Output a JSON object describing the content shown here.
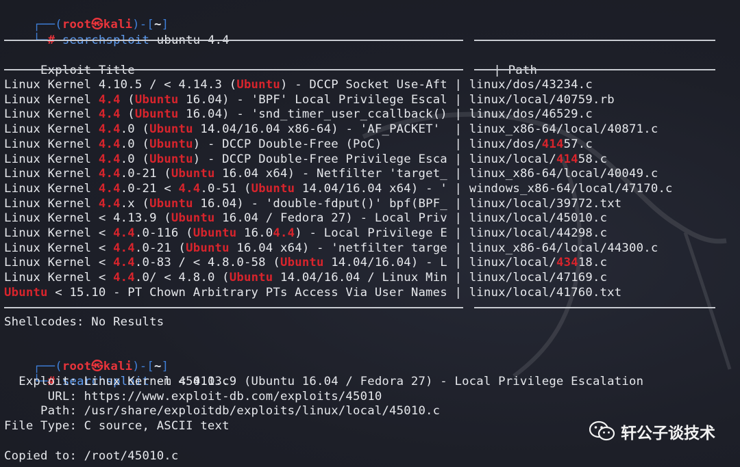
{
  "prompt": {
    "open": "┌──(",
    "user": "root",
    "skull": "㉿",
    "host": "kali",
    "mid": ")-[",
    "dir": "~",
    "close": "]",
    "second": "└─",
    "hash": "#"
  },
  "command1": {
    "name": "searchsploit",
    "args": " ubuntu 4.4"
  },
  "table": {
    "header_title": " Exploit Title",
    "header_sep": "|",
    "header_path": " Path",
    "rows": [
      {
        "segs": [
          [
            "n",
            "Linux Kernel 4.10.5 / < 4.14.3 ("
          ],
          [
            "h",
            "Ubuntu"
          ],
          [
            "n",
            ") - DCCP Socket Use-Aft | linux/dos/43234.c"
          ]
        ]
      },
      {
        "segs": [
          [
            "n",
            "Linux Kernel "
          ],
          [
            "h",
            "4.4"
          ],
          [
            "n",
            " ("
          ],
          [
            "h",
            "Ubuntu"
          ],
          [
            "n",
            " 16.04) - 'BPF' Local Privilege Escal | linux/local/40759.rb"
          ]
        ]
      },
      {
        "segs": [
          [
            "n",
            "Linux Kernel "
          ],
          [
            "h",
            "4.4"
          ],
          [
            "n",
            " ("
          ],
          [
            "h",
            "Ubuntu"
          ],
          [
            "n",
            " 16.04) - 'snd_timer_user_ccallback() | linux/dos/46529.c"
          ]
        ]
      },
      {
        "segs": [
          [
            "n",
            "Linux Kernel "
          ],
          [
            "h",
            "4.4"
          ],
          [
            "n",
            ".0 ("
          ],
          [
            "h",
            "Ubuntu"
          ],
          [
            "n",
            " 14.04/16.04 x86-64) - 'AF_PACKET'  | linux_x86-64/local/40871.c"
          ]
        ]
      },
      {
        "segs": [
          [
            "n",
            "Linux Kernel "
          ],
          [
            "h",
            "4.4"
          ],
          [
            "n",
            ".0 ("
          ],
          [
            "h",
            "Ubuntu"
          ],
          [
            "n",
            ") - DCCP Double-Free (PoC)          | linux/dos/"
          ],
          [
            "h",
            "414"
          ],
          [
            "n",
            "57.c"
          ]
        ]
      },
      {
        "segs": [
          [
            "n",
            "Linux Kernel "
          ],
          [
            "h",
            "4.4"
          ],
          [
            "n",
            ".0 ("
          ],
          [
            "h",
            "Ubuntu"
          ],
          [
            "n",
            ") - DCCP Double-Free Privilege Esca | linux/local/"
          ],
          [
            "h",
            "414"
          ],
          [
            "n",
            "58.c"
          ]
        ]
      },
      {
        "segs": [
          [
            "n",
            "Linux Kernel "
          ],
          [
            "h",
            "4.4"
          ],
          [
            "n",
            ".0-21 ("
          ],
          [
            "h",
            "Ubuntu"
          ],
          [
            "n",
            " 16.04 x64) - Netfilter 'target_ | linux_x86-64/local/40049.c"
          ]
        ]
      },
      {
        "segs": [
          [
            "n",
            "Linux Kernel "
          ],
          [
            "h",
            "4.4"
          ],
          [
            "n",
            ".0-21 < "
          ],
          [
            "h",
            "4.4"
          ],
          [
            "n",
            ".0-51 ("
          ],
          [
            "h",
            "Ubuntu"
          ],
          [
            "n",
            " 14.04/16.04 x64) - ' | windows_x86-64/local/47170.c"
          ]
        ]
      },
      {
        "segs": [
          [
            "n",
            "Linux Kernel "
          ],
          [
            "h",
            "4.4"
          ],
          [
            "n",
            ".x ("
          ],
          [
            "h",
            "Ubuntu"
          ],
          [
            "n",
            " 16.04) - 'double-fdput()' bpf(BPF_ | linux/local/39772.txt"
          ]
        ]
      },
      {
        "segs": [
          [
            "n",
            "Linux Kernel < 4.13.9 ("
          ],
          [
            "h",
            "Ubuntu"
          ],
          [
            "n",
            " 16.04 / Fedora 27) - Local Priv | linux/local/45010.c"
          ]
        ]
      },
      {
        "segs": [
          [
            "n",
            "Linux Kernel < "
          ],
          [
            "h",
            "4.4"
          ],
          [
            "n",
            ".0-116 ("
          ],
          [
            "h",
            "Ubuntu"
          ],
          [
            "n",
            " 16.0"
          ],
          [
            "h",
            "4.4"
          ],
          [
            "n",
            ") - Local Privilege E | linux/local/44298.c"
          ]
        ]
      },
      {
        "segs": [
          [
            "n",
            "Linux Kernel < "
          ],
          [
            "h",
            "4.4"
          ],
          [
            "n",
            ".0-21 ("
          ],
          [
            "h",
            "Ubuntu"
          ],
          [
            "n",
            " 16.04 x64) - 'netfilter targe | linux_x86-64/local/44300.c"
          ]
        ]
      },
      {
        "segs": [
          [
            "n",
            "Linux Kernel < "
          ],
          [
            "h",
            "4.4"
          ],
          [
            "n",
            ".0-83 / < 4.8.0-58 ("
          ],
          [
            "h",
            "Ubuntu"
          ],
          [
            "n",
            " 14.04/16.04) - L | linux/local/"
          ],
          [
            "h",
            "434"
          ],
          [
            "n",
            "18.c"
          ]
        ]
      },
      {
        "segs": [
          [
            "n",
            "Linux Kernel < "
          ],
          [
            "h",
            "4.4"
          ],
          [
            "n",
            ".0/ < 4.8.0 ("
          ],
          [
            "h",
            "Ubuntu"
          ],
          [
            "n",
            " 14.04/16.04 / Linux Min | linux/local/47169.c"
          ]
        ]
      },
      {
        "segs": [
          [
            "h",
            "Ubuntu"
          ],
          [
            "n",
            " < 15.10 - PT Chown Arbitrary PTs Access Via User Names | linux/local/41760.txt"
          ]
        ]
      }
    ]
  },
  "shellcodes": "Shellcodes: No Results",
  "command2": {
    "name": "searchsploit",
    "args": " -m 45010.c"
  },
  "details": [
    "  Exploit: Linux Kernel < 4.13.9 (Ubuntu 16.04 / Fedora 27) - Local Privilege Escalation",
    "      URL: https://www.exploit-db.com/exploits/45010",
    "     Path: /usr/share/exploitdb/exploits/linux/local/45010.c",
    "File Type: C source, ASCII text",
    "",
    "Copied to: /root/45010.c"
  ],
  "watermark": "轩公子谈技术",
  "colors": {
    "background": "#1d1f28",
    "prompt_frame": "#3f7fd8",
    "prompt_user": "#e8343b",
    "highlight": "#d8242c",
    "text": "#e6e8ec"
  }
}
